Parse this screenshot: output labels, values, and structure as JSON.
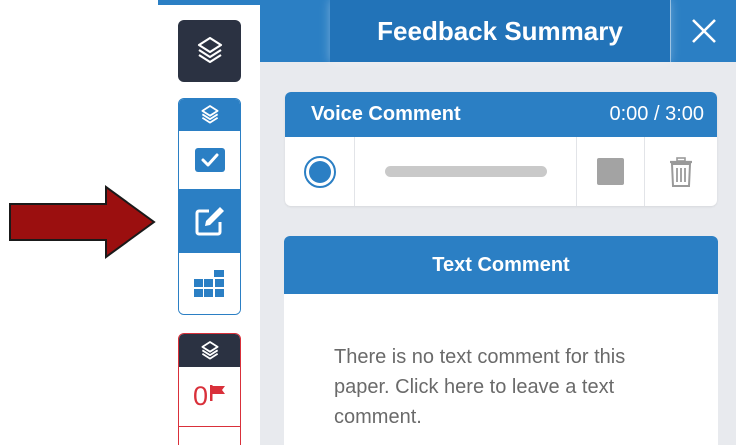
{
  "panel": {
    "title": "Feedback Summary",
    "close_icon": "close-icon"
  },
  "voice_comment": {
    "title": "Voice Comment",
    "time": "0:00 / 3:00",
    "progress": 0
  },
  "text_comment": {
    "title": "Text Comment",
    "placeholder": "There is no text comment for this paper. Click here to leave a text comment."
  },
  "tools": {
    "flag_count": "0",
    "active_tool": "comment"
  },
  "colors": {
    "accent": "#2b7fc4",
    "dark": "#2b3242",
    "flag": "#d9303a",
    "arrow": "#9b0f0f"
  }
}
